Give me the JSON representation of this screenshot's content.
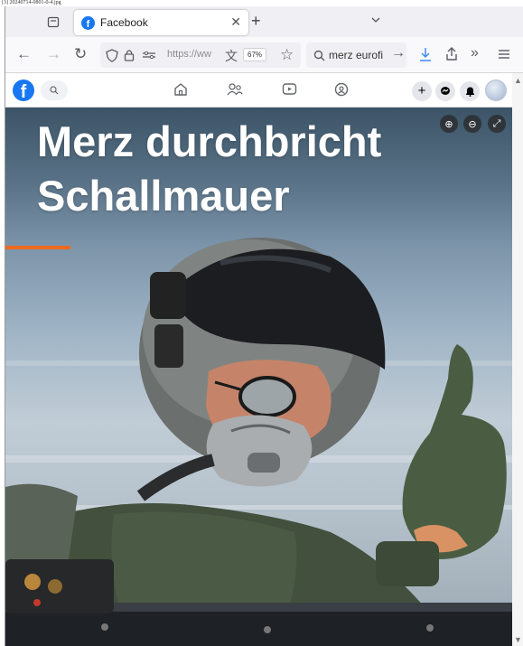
{
  "file_caption": "[3] 20240714-0801-0-4.jpg",
  "browser": {
    "tab": {
      "title": "Facebook",
      "favicon_letter": "f"
    },
    "address_bar": {
      "url_display": "https://ww",
      "zoom_level": "67%"
    },
    "search_box": {
      "value": "merz eurofi"
    }
  },
  "facebook": {
    "logo_letter": "f"
  },
  "post_image": {
    "headline_line1": "Merz durchbricht",
    "headline_line2": "Schallmauer",
    "accent_color": "#ee6a1f"
  },
  "icons": {
    "tab_overview": "tab-overview-icon",
    "tab_close": "close-icon",
    "new_tab": "plus-icon",
    "list_tabs": "chevron-down-icon",
    "back": "back-arrow-icon",
    "forward": "forward-arrow-icon",
    "reload": "reload-icon",
    "tracking_protection": "shield-icon",
    "site_lock": "lock-icon",
    "permissions": "permissions-icon",
    "translate": "translate-icon",
    "bookmark": "star-icon",
    "search": "search-icon",
    "search_go": "arrow-right-icon",
    "downloads": "download-icon",
    "share": "share-icon",
    "overflow": "double-chevron-icon",
    "menu": "hamburger-menu-icon"
  },
  "colors": {
    "facebook_blue": "#1877f2",
    "headline_text": "#ffffff"
  }
}
